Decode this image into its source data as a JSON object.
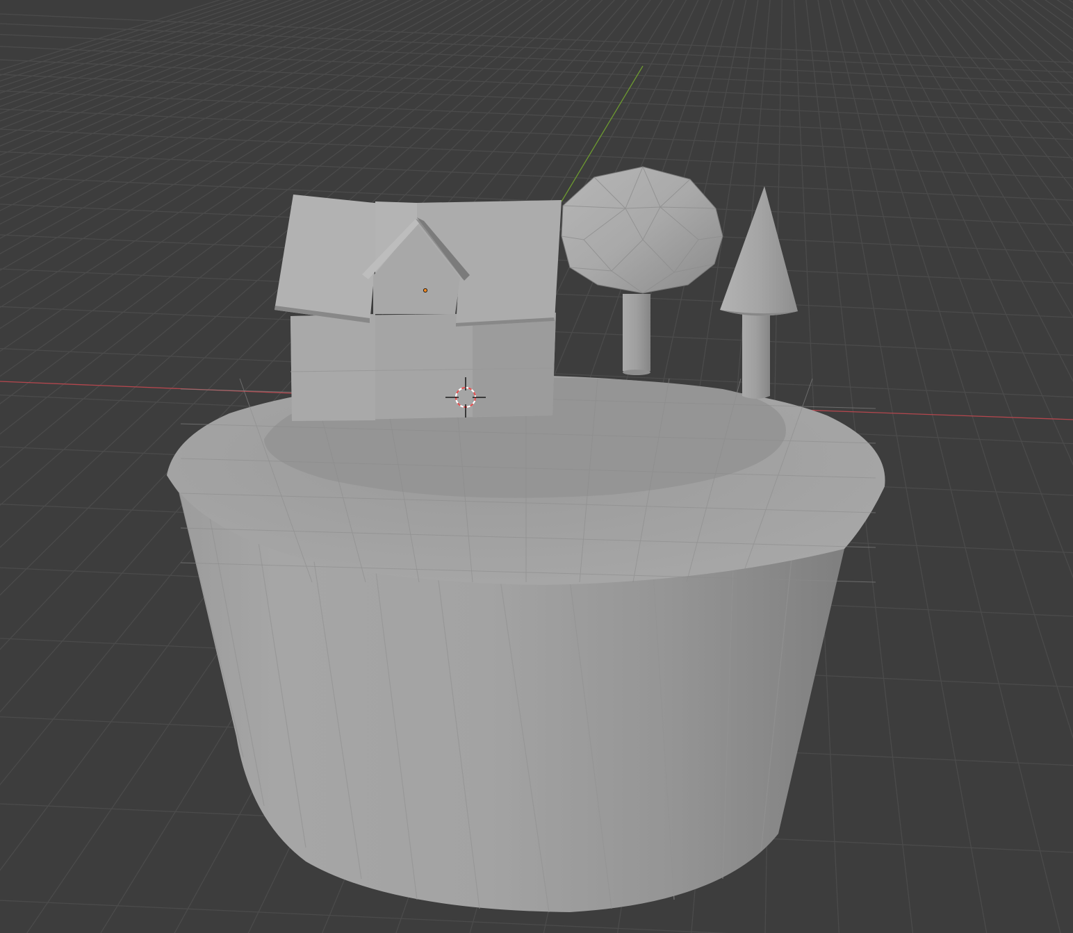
{
  "viewport": {
    "background": "#3d3d3d",
    "grid_color": "#4b4b4b",
    "x_axis_color": "#b5474e",
    "y_axis_color": "#6d9a30"
  },
  "scene": {
    "objects": [
      {
        "name": "base-cylinder",
        "type": "truncated-cone-mesh"
      },
      {
        "name": "house",
        "type": "box-with-roof"
      },
      {
        "name": "dormer",
        "type": "gable"
      },
      {
        "name": "tree-round",
        "type": "icosphere-on-cylinder"
      },
      {
        "name": "tree-cone",
        "type": "cone-on-cylinder"
      }
    ],
    "mesh_color": "#a2a2a2"
  },
  "cursor_3d": {
    "name": "3d-cursor",
    "colors": [
      "#e05050",
      "#ffffff"
    ]
  },
  "origin_marker": {
    "color": "#f08a24"
  }
}
